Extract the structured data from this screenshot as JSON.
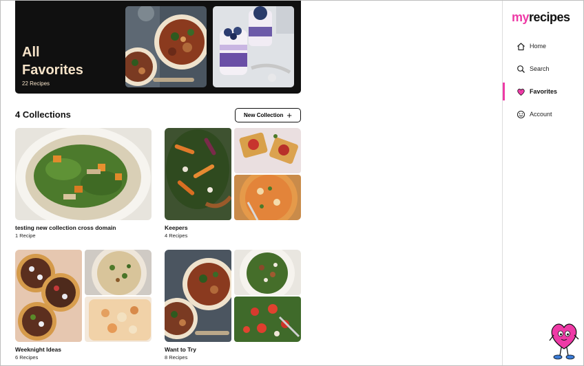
{
  "brand": {
    "my": "my",
    "recipes": "recipes",
    "accent": "#ee3aa6"
  },
  "hero": {
    "line1": "All",
    "line2": "Favorites",
    "count": "22 Recipes"
  },
  "collections": {
    "heading": "4 Collections",
    "new_button": "New Collection",
    "items": [
      {
        "title": "testing new collection cross domain",
        "count": "1 Recipe"
      },
      {
        "title": "Keepers",
        "count": "4 Recipes"
      },
      {
        "title": "Weeknight Ideas",
        "count": "6 Recipes"
      },
      {
        "title": "Want to Try",
        "count": "8 Recipes"
      }
    ]
  },
  "nav": [
    {
      "label": "Home",
      "icon": "home-icon"
    },
    {
      "label": "Search",
      "icon": "search-icon"
    },
    {
      "label": "Favorites",
      "icon": "heart-icon",
      "active": true
    },
    {
      "label": "Account",
      "icon": "smiley-icon"
    }
  ]
}
